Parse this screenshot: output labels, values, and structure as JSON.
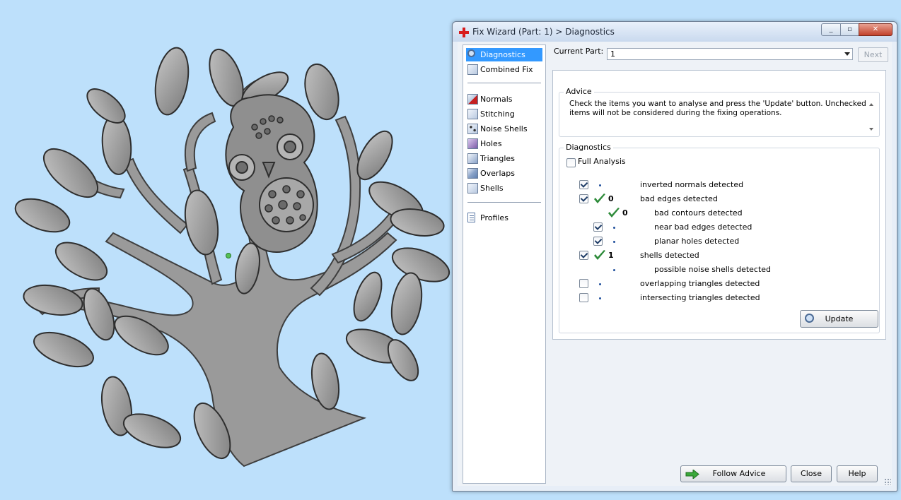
{
  "window": {
    "title": "Fix Wizard (Part: 1) > Diagnostics",
    "controls": {
      "minimize": "_",
      "maximize": "▫",
      "close": "✕"
    }
  },
  "nav": {
    "items": [
      {
        "label": "Diagnostics",
        "icon": "magnifier-icon",
        "selected": true
      },
      {
        "label": "Combined Fix",
        "icon": "cube-icon"
      },
      {
        "label": "Normals",
        "icon": "normals-cube-icon"
      },
      {
        "label": "Stitching",
        "icon": "stitching-cube-icon"
      },
      {
        "label": "Noise Shells",
        "icon": "noise-shells-cube-icon"
      },
      {
        "label": "Holes",
        "icon": "holes-cube-icon"
      },
      {
        "label": "Triangles",
        "icon": "triangles-cube-icon"
      },
      {
        "label": "Overlaps",
        "icon": "overlaps-cube-icon"
      },
      {
        "label": "Shells",
        "icon": "shells-cube-icon"
      },
      {
        "label": "Profiles",
        "icon": "document-icon"
      }
    ]
  },
  "current_part": {
    "label": "Current Part:",
    "value": "1"
  },
  "next_label": "Next",
  "advice": {
    "title": "Advice",
    "text": "Check the items you want to analyse and press the 'Update' button. Unchecked items will not be considered during the fixing operations."
  },
  "diagnostics": {
    "title": "Diagnostics",
    "full_analysis": {
      "label": "Full Analysis",
      "checked": false
    },
    "rows": [
      {
        "label": "inverted normals detected",
        "checked": true,
        "value": "",
        "ok": false
      },
      {
        "label": "bad edges detected",
        "checked": true,
        "value": "0",
        "ok": true
      },
      {
        "label": "bad contours detected",
        "checked": null,
        "value": "0",
        "ok": true
      },
      {
        "label": "near bad edges detected",
        "checked": true,
        "value": "",
        "ok": false
      },
      {
        "label": "planar holes detected",
        "checked": true,
        "value": "",
        "ok": false
      },
      {
        "label": "shells detected",
        "checked": true,
        "value": "1",
        "ok": true
      },
      {
        "label": "possible noise shells detected",
        "checked": null,
        "value": "",
        "ok": false
      },
      {
        "label": "overlapping triangles detected",
        "checked": false,
        "value": "",
        "ok": false
      },
      {
        "label": "intersecting triangles detected",
        "checked": false,
        "value": "",
        "ok": false
      }
    ],
    "update_label": "Update"
  },
  "buttons": {
    "follow_advice": "Follow Advice",
    "close": "Close",
    "help": "Help"
  },
  "colors": {
    "desktop": "#bde0fb",
    "model": "#9a9a9a",
    "selection": "#3399ff",
    "ok_tick": "#2e8b3a"
  }
}
